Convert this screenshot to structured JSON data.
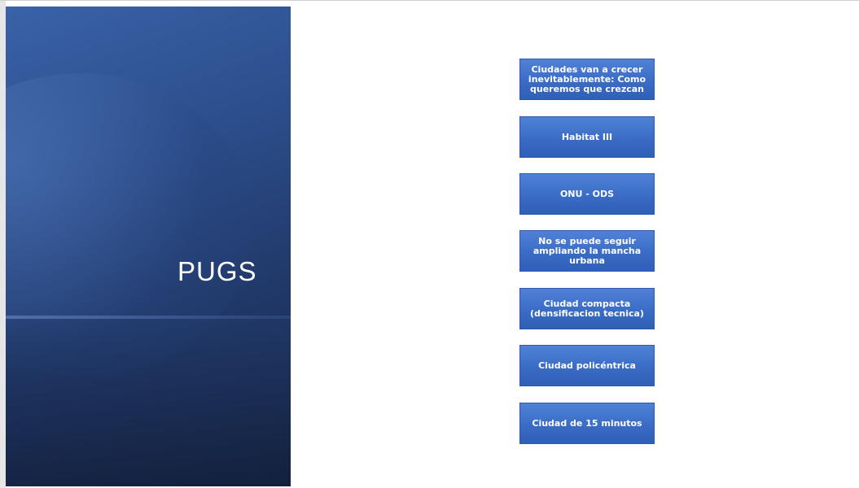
{
  "slide": {
    "title": "PUGS",
    "boxes": [
      "Ciudades van a crecer inevitablemente: Como queremos que crezcan",
      "Habitat III",
      "ONU - ODS",
      "No se puede seguir ampliando la mancha urbana",
      "Ciudad compacta (densificacion tecnica)",
      "Ciudad policéntrica",
      "Ciudad de 15 minutos"
    ]
  },
  "colors": {
    "panel_dark": "#1f3563",
    "panel_light": "#3a62a8",
    "box_fill": "#3a6cc6",
    "box_border": "#2e5aa8",
    "text": "#ffffff"
  }
}
